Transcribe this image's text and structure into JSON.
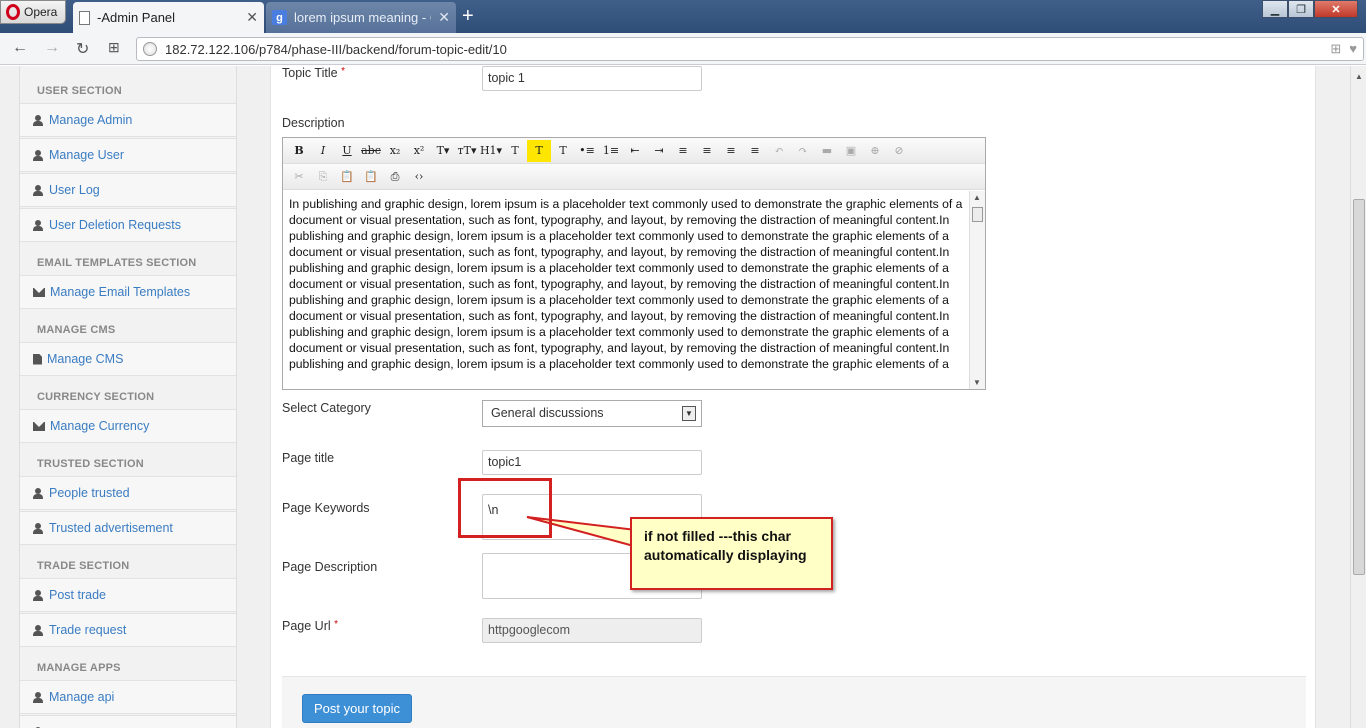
{
  "browser": {
    "menu_label": "Opera",
    "tabs": [
      {
        "title": "-Admin Panel"
      },
      {
        "title": "lorem ipsum meaning - Go"
      }
    ],
    "address": "182.72.122.106/p784/phase-III/backend/forum-topic-edit/10"
  },
  "sidebar": {
    "sections": [
      {
        "title": "USER SECTION",
        "items": [
          "Manage Admin",
          "Manage User",
          "User Log",
          "User Deletion Requests"
        ]
      },
      {
        "title": "EMAIL TEMPLATES SECTION",
        "items": [
          "Manage Email Templates"
        ]
      },
      {
        "title": "MANAGE CMS",
        "items": [
          "Manage CMS"
        ]
      },
      {
        "title": "CURRENCY SECTION",
        "items": [
          "Manage Currency"
        ]
      },
      {
        "title": "TRUSTED SECTION",
        "items": [
          "People trusted",
          "Trusted advertisement"
        ]
      },
      {
        "title": "TRADE SECTION",
        "items": [
          "Post trade",
          "Trade request"
        ]
      },
      {
        "title": "MANAGE APPS",
        "items": [
          "Manage api"
        ]
      }
    ]
  },
  "form": {
    "topic_title_label": "Topic Title",
    "required_mark": "*",
    "topic_title_value": "topic 1",
    "description_label": "Description",
    "description_text": "In publishing and graphic design, lorem ipsum is a placeholder text commonly used to demonstrate the graphic elements of a document or visual presentation, such as font, typography, and layout, by removing the distraction of meaningful content.In publishing and graphic design, lorem ipsum is a placeholder text commonly used to demonstrate the graphic elements of a document or visual presentation, such as font, typography, and layout, by removing the distraction of meaningful content.In publishing and graphic design, lorem ipsum is a placeholder text commonly used to demonstrate the graphic elements of a document or visual presentation, such as font, typography, and layout, by removing the distraction of meaningful content.In publishing and graphic design, lorem ipsum is a placeholder text commonly used to demonstrate the graphic elements of a document or visual presentation, such as font, typography, and layout, by removing the distraction of meaningful content.In publishing and graphic design, lorem ipsum is a placeholder text commonly used to demonstrate the graphic elements of a document or visual presentation, such as font, typography, and layout, by removing the distraction of meaningful content.In publishing and graphic design, lorem ipsum is a placeholder text commonly used to demonstrate the graphic elements of a",
    "category_label": "Select Category",
    "category_value": "General discussions",
    "page_title_label": "Page title",
    "page_title_value": "topic1",
    "page_keywords_label": "Page Keywords",
    "page_keywords_value": "\\n",
    "page_description_label": "Page Description",
    "page_description_value": "",
    "page_url_label": "Page Url",
    "page_url_value": "httpgooglecom",
    "submit_label": "Post your topic"
  },
  "editor_toolbar": {
    "row1": [
      "B",
      "I",
      "U",
      "abc",
      "x₂",
      "x²",
      "T▾",
      "тT▾",
      "H1▾",
      "T",
      "T",
      "T",
      "•≡",
      "1≡",
      "⇤",
      "⇥",
      "≡",
      "≡",
      "≡",
      "≡",
      "↶",
      "↷",
      "▬",
      "▣",
      "⊕",
      "⊘"
    ],
    "row2": [
      "✂",
      "⎘",
      "📋",
      "📋",
      "⎙",
      "‹›"
    ]
  },
  "annotation": {
    "text": "if not filled ---this char automatically displaying"
  }
}
